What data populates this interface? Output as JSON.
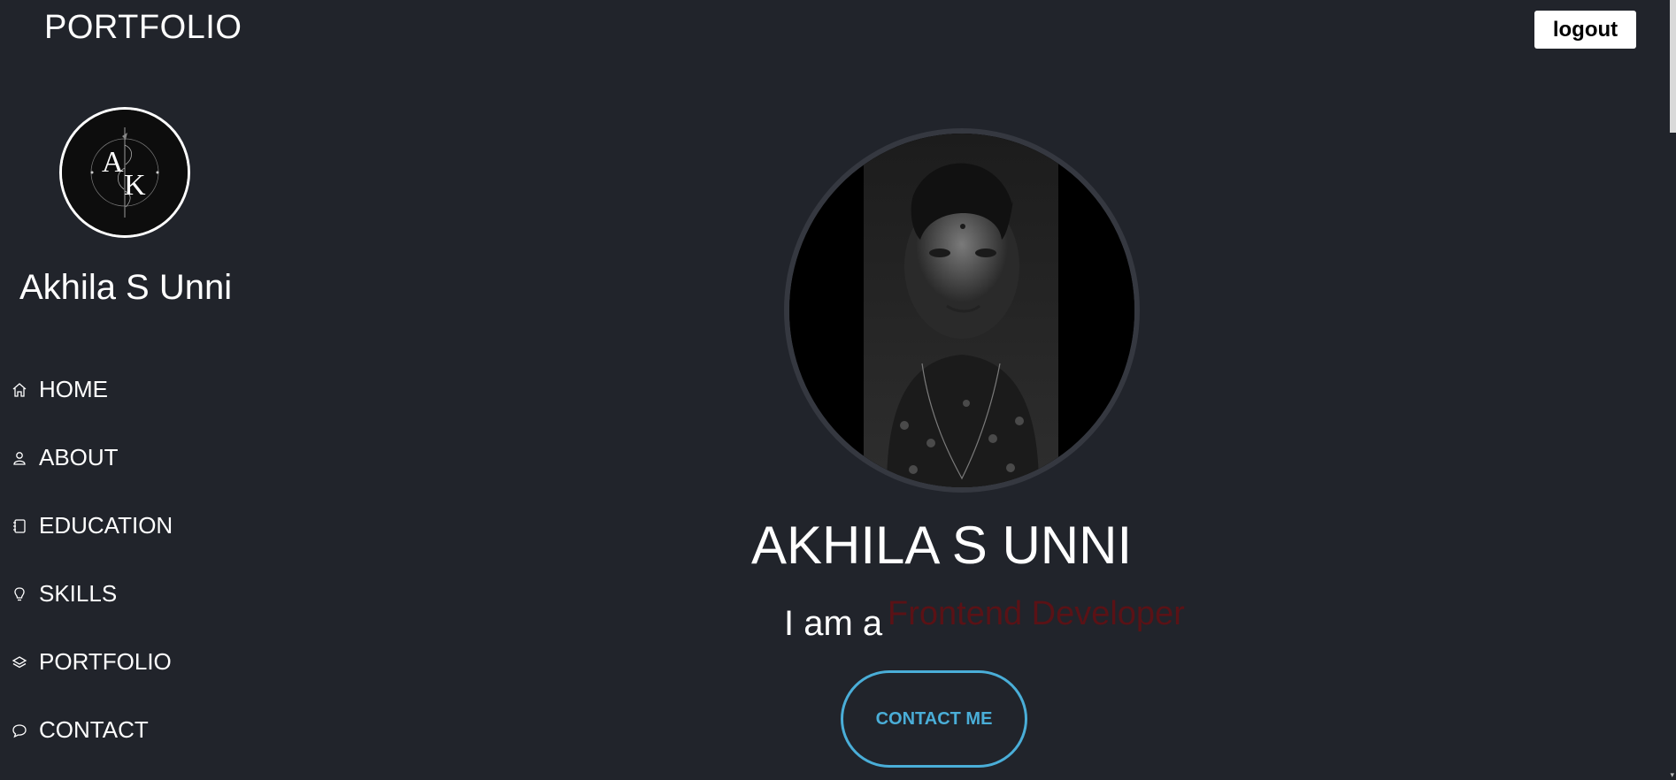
{
  "header": {
    "brand": "PORTFOLIO",
    "logout_label": "logout"
  },
  "sidebar": {
    "logo_alt": "AK",
    "name": "Akhila S Unni",
    "items": [
      {
        "label": "HOME",
        "icon": "home-icon"
      },
      {
        "label": "ABOUT",
        "icon": "user-icon"
      },
      {
        "label": "EDUCATION",
        "icon": "notebook-icon"
      },
      {
        "label": "SKILLS",
        "icon": "lightbulb-icon"
      },
      {
        "label": "PORTFOLIO",
        "icon": "layers-icon"
      },
      {
        "label": "CONTACT",
        "icon": "chat-icon"
      }
    ]
  },
  "hero": {
    "name": "AKHILA S UNNI",
    "intro": "I am a",
    "role": "Frontend Developer",
    "contact_label": "CONTACT ME"
  },
  "colors": {
    "background": "#21242b",
    "accent": "#4aaed8",
    "role_text": "#5a1216"
  }
}
